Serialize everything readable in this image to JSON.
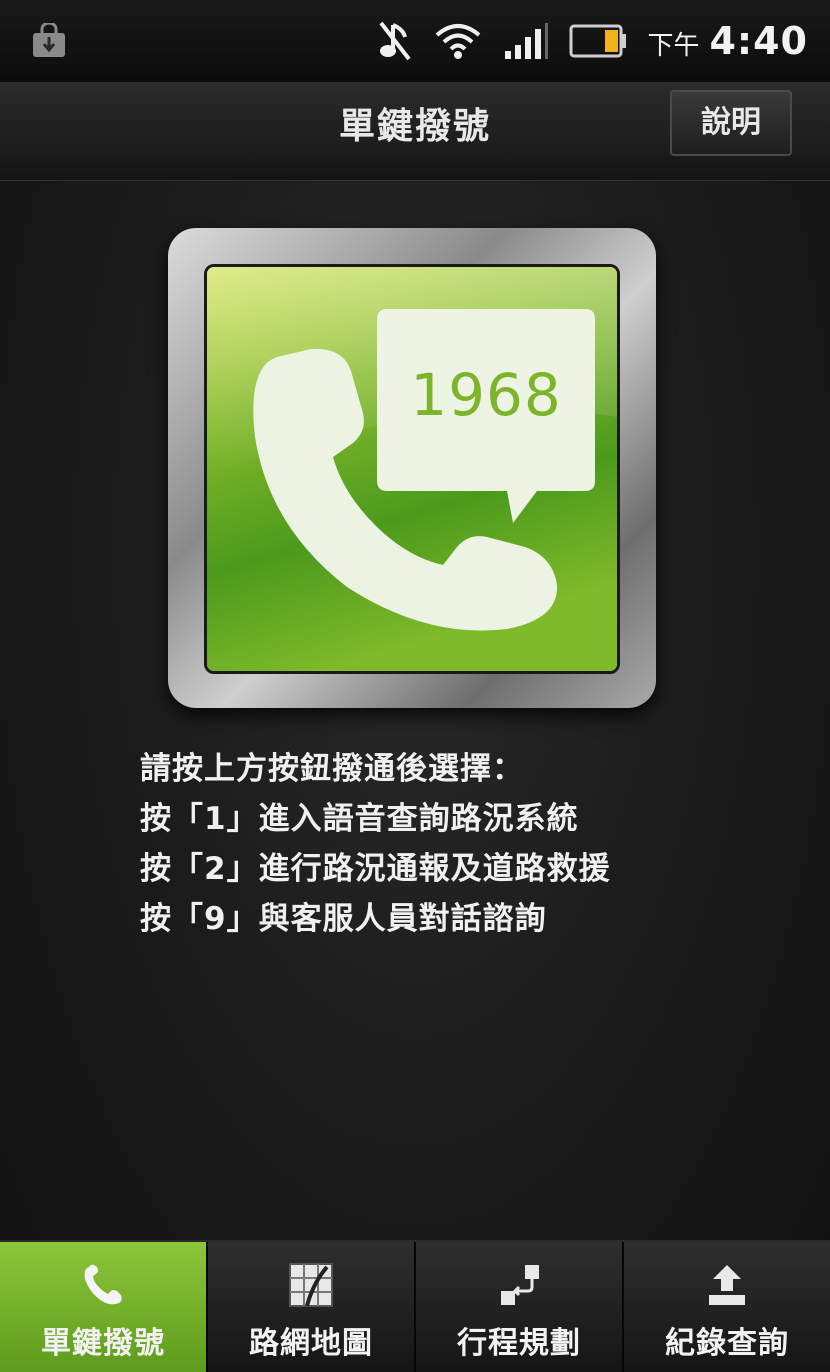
{
  "status_bar": {
    "icons": [
      "shopping-bag-icon",
      "music-muted-icon",
      "wifi-icon",
      "signal-icon",
      "battery-icon"
    ],
    "clock_ampm": "下午",
    "clock_time": "4:40"
  },
  "header": {
    "title": "單鍵撥號",
    "help_label": "說明"
  },
  "dial_button": {
    "number": "1968",
    "icon": "phone-handset-icon",
    "colors": {
      "green_light": "#c8dc3c",
      "green_dark": "#3f8a1a"
    }
  },
  "instructions": [
    "請按上方按鈕撥通後選擇：",
    "按「1」進入語音查詢路況系統",
    "按「2」進行路況通報及道路救援",
    "按「9」與客服人員對話諮詢"
  ],
  "tabs": [
    {
      "label": "單鍵撥號",
      "icon": "phone-icon",
      "active": true
    },
    {
      "label": "路網地圖",
      "icon": "map-icon",
      "active": false
    },
    {
      "label": "行程規劃",
      "icon": "route-icon",
      "active": false
    },
    {
      "label": "紀錄查詢",
      "icon": "upload-icon",
      "active": false
    }
  ],
  "colors": {
    "accent": "#7cb82f",
    "background": "#1b1b1b"
  }
}
